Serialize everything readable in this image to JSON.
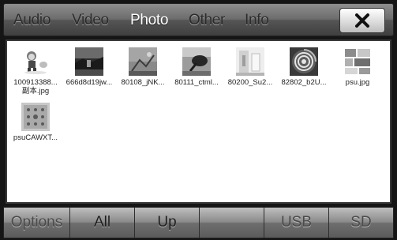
{
  "tabs": {
    "audio": "Audio",
    "video": "Video",
    "photo": "Photo",
    "other": "Other",
    "info": "Info"
  },
  "active_tab": "Photo",
  "close_icon": "close-x-icon",
  "files": [
    {
      "name": "100913388...",
      "name2": "副本.jpg",
      "icon": "cartoon-character-thumbnail"
    },
    {
      "name": "666d8d19jw...",
      "icon": "dark-landscape-thumbnail"
    },
    {
      "name": "80108_jNK...",
      "icon": "grey-scene-thumbnail"
    },
    {
      "name": "80111_ctml...",
      "icon": "dark-object-thumbnail"
    },
    {
      "name": "80200_Su2...",
      "icon": "light-interior-thumbnail"
    },
    {
      "name": "82802_b2U...",
      "icon": "spiral-thumbnail"
    },
    {
      "name": "psu.jpg",
      "icon": "collage-thumbnail"
    },
    {
      "name": "psuCAWXT...",
      "icon": "pattern-thumbnail"
    }
  ],
  "bottom": {
    "options": "Options",
    "all": "All",
    "up": "Up",
    "blank": "",
    "usb": "USB",
    "sd": "SD"
  }
}
